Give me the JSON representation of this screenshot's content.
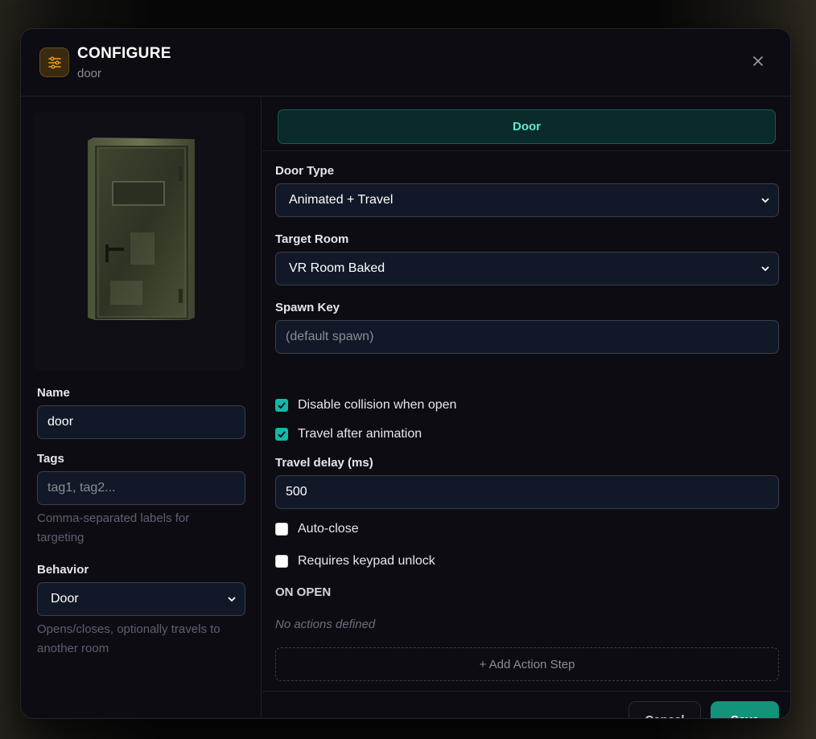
{
  "dialog": {
    "title": "CONFIGURE",
    "subtitle": "door"
  },
  "left_panel": {
    "name_label": "Name",
    "name_value": "door",
    "tags_label": "Tags",
    "tags_placeholder": "tag1, tag2...",
    "tags_help": "Comma-separated labels for targeting",
    "behavior_label": "Behavior",
    "behavior_value": "Door",
    "behavior_help": "Opens/closes, optionally travels to another room"
  },
  "right_panel": {
    "tab_label": "Door",
    "door_type_label": "Door Type",
    "door_type_value": "Animated + Travel",
    "target_room_label": "Target Room",
    "target_room_value": "VR Room Baked",
    "spawn_key_label": "Spawn Key",
    "spawn_key_placeholder": "(default spawn)",
    "checkboxes": [
      {
        "label": "Disable collision when open",
        "checked": true
      },
      {
        "label": "Travel after animation",
        "checked": true
      }
    ],
    "travel_delay_label": "Travel delay (ms)",
    "travel_delay_value": "500",
    "checkboxes2": [
      {
        "label": "Auto-close",
        "checked": false
      },
      {
        "label": "Requires keypad unlock",
        "checked": false
      }
    ],
    "on_open_title": "ON OPEN",
    "no_actions_text": "No actions defined",
    "add_action_label": "+ Add Action Step"
  },
  "footer": {
    "cancel_label": "Cancel",
    "save_label": "Save"
  },
  "colors": {
    "accent": "#14b8a6",
    "save": "#13937a",
    "icon_orange": "#f59e0b"
  }
}
